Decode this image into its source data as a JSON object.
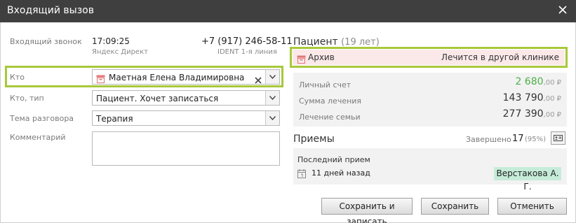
{
  "window": {
    "title": "Входящий вызов"
  },
  "call": {
    "label": "Входящий звонок",
    "time": "17:09:25",
    "source": "Яндекс Директ",
    "phone": "+7 (917) 246-58-11",
    "line": "IDENT 1-я линия"
  },
  "form": {
    "who_label": "Кто",
    "who_value": "Маетная Елена Владимировна",
    "type_label": "Кто, тип",
    "type_value": "Пациент. Хочет записаться",
    "topic_label": "Тема разговора",
    "topic_value": "Терапия",
    "comment_label": "Комментарий",
    "comment_value": ""
  },
  "patient": {
    "title": "Пациент",
    "age": "(19 лет)",
    "archive_label": "Архив",
    "archive_note": "Лечится в другой клинике"
  },
  "finance": {
    "rows": [
      {
        "label": "Личный счет",
        "value": "2 680",
        "cents": ",00 ₽"
      },
      {
        "label": "Сумма лечения",
        "value": "143 790",
        "cents": ",00 ₽"
      },
      {
        "label": "Лечение семьи",
        "value": "277 390",
        "cents": ",00 ₽"
      }
    ]
  },
  "visits": {
    "title": "Приемы",
    "completed_label": "Завершено",
    "completed_count": "17",
    "completed_pct": "(95%)",
    "last_label": "Последний прием",
    "last_ago": "11 дней назад",
    "doctor": "Верстакова А. Г."
  },
  "buttons": {
    "save_and_book": "Сохранить и записать",
    "save": "Сохранить",
    "cancel": "Отменить"
  },
  "colors": {
    "accent_green": "#a7c93a",
    "archive_red": "#e07676",
    "balance_green": "#4db04a"
  }
}
